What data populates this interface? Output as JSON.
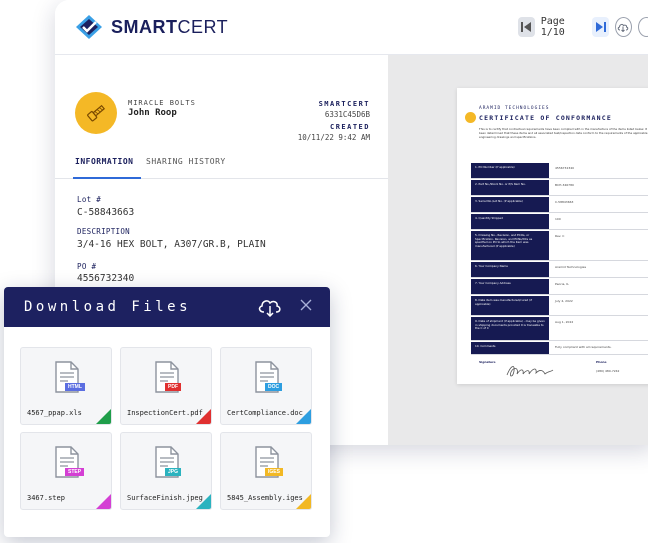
{
  "app": {
    "logo_text_bold": "SMART",
    "logo_text_thin": "CERT"
  },
  "viewer": {
    "page_indicator": "Page 1/10"
  },
  "record": {
    "company": "MIRACLE BOLTS",
    "person": "John Roop",
    "brand_label": "SMARTCERT",
    "cert_id": "6331C45D6B",
    "created_label": "CREATED",
    "created_value": "10/11/22 9:42 AM"
  },
  "tabs": [
    {
      "label": "INFORMATION",
      "active": true
    },
    {
      "label": "SHARING HISTORY",
      "active": false
    }
  ],
  "fields": [
    {
      "label": "Lot #",
      "value": "C-58843663"
    },
    {
      "label": "DESCRIPTION",
      "value": "3/4-16 HEX BOLT, A307/GR.B, PLAIN"
    },
    {
      "label": "PO #",
      "value": "4556732340"
    }
  ],
  "certificate": {
    "org": "ARAMID TECHNOLOGIES",
    "title": "CERTIFICATE OF CONFORMANCE",
    "intro": "This is to certify that contractual requirements have been complied with in the manufacture of the items listed below. It has been determined that these items and all associated test/inspection data conform to the requirements of the applicable engineering drawings and specifications.",
    "rows": [
      {
        "key": "1. PO Number (if applicable)",
        "value": "4556732340"
      },
      {
        "key": "2. Part No./Stock No. or P/S Item No.",
        "value": "BCH-346780"
      },
      {
        "key": "3. Serial No./Lot No. (if applicable)",
        "value": "C-58843663"
      },
      {
        "key": "4. Quantity Shipped",
        "value": "100"
      },
      {
        "key": "5. Drawing No., Revision, and ECOs, or Specification, Revision, and ECNs/DCs as specified on PO to which the item was manufactured (if applicable)",
        "value": "Rev. C"
      },
      {
        "key": "6. Your Company Name",
        "value": "Aramid Technologies"
      },
      {
        "key": "7. Your Company Address",
        "value": "Peoria, IL"
      },
      {
        "key": "8. Date item was manufactured/cured (if applicable)",
        "value": "July 4, 2022"
      },
      {
        "key": "9. Date of shipment (if applicable) - may be given in shipping documents provided it is traceable to the C of C",
        "value": "Aug 1, 2022"
      },
      {
        "key": "10. Comments",
        "value": "Fully compliant with all requirements."
      }
    ],
    "signature_label": "Signature",
    "phone_label": "Phone",
    "phone_value": "(480) 480-7242"
  },
  "download": {
    "title": "Download Files",
    "files": [
      {
        "name": "4567_ppap.xls",
        "badge": "HTML",
        "badge_color": "#5b6ee1",
        "fold_color": "#1f9e4a"
      },
      {
        "name": "InspectionCert.pdf",
        "badge": "PDF",
        "badge_color": "#e03030",
        "fold_color": "#e03030"
      },
      {
        "name": "CertCompliance.doc",
        "badge": "DOC",
        "badge_color": "#2d9ee0",
        "fold_color": "#2d9ee0"
      },
      {
        "name": "3467.step",
        "badge": "STEP",
        "badge_color": "#d43fd4",
        "fold_color": "#d43fd4"
      },
      {
        "name": "SurfaceFinish.jpeg",
        "badge": "JPG",
        "badge_color": "#2bb3bf",
        "fold_color": "#2bb3bf"
      },
      {
        "name": "5845_Assembly.iges",
        "badge": "IGES",
        "badge_color": "#f2b824",
        "fold_color": "#f2b824"
      }
    ]
  },
  "colors": {
    "navy": "#1d2160",
    "accent_blue": "#2f6ad8",
    "gold": "#f4b826"
  }
}
